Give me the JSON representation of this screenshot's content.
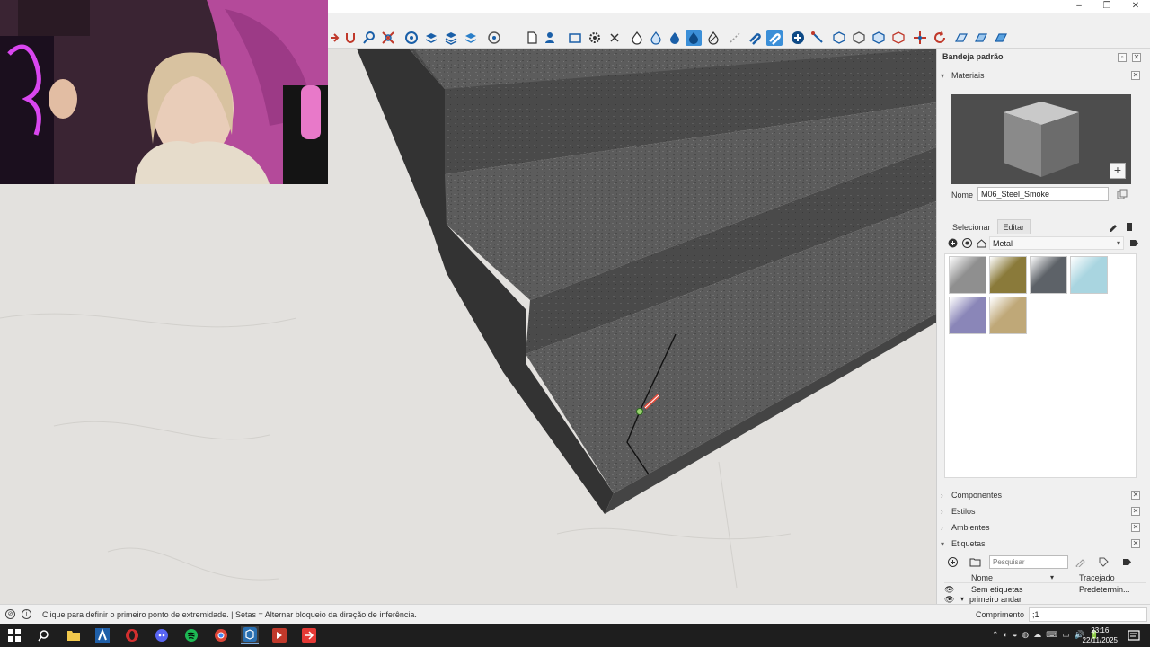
{
  "window": {
    "minimize_label": "–",
    "restore_label": "❐",
    "close_label": "✕"
  },
  "toolbar": {
    "active_tool": "paint-bucket-icon",
    "icons": [
      "scale-icon",
      "rotate-icon",
      "zoom-icon",
      "zoom-extents-icon",
      "section-icon",
      "layers-icon",
      "layers2-icon",
      "styles-icon",
      "page-icon",
      "person-icon",
      "rectangle-icon",
      "settings-icon",
      "close-icon",
      "drop1-icon",
      "drop2-icon",
      "drop3-icon",
      "paint-bucket-icon",
      "eraser-icon",
      "grid-icon",
      "magnet-icon",
      "magnet2-icon",
      "add-icon",
      "wand-icon",
      "solid1-icon",
      "solid2-icon",
      "solid3-icon",
      "solid4-icon",
      "move-icon",
      "rotate2-icon",
      "grid1-icon",
      "grid2-icon",
      "grid3-icon"
    ]
  },
  "tray": {
    "title": "Bandeja padrão",
    "materials_title": "Materiais",
    "name_label": "Nome",
    "name_value": "M06_Steel_Smoke",
    "tab_select": "Selecionar",
    "tab_edit": "Editar",
    "library_value": "Metal",
    "swatch_colors": [
      "#8f8f8f",
      "#8a7a3a",
      "#5d6268",
      "#a9d5e0",
      "#8a86b8",
      "#bfa878"
    ],
    "sections": {
      "components": "Componentes",
      "styles": "Estilos",
      "environments": "Ambientes",
      "tags": "Etiquetas"
    },
    "tags": {
      "search_placeholder": "Pesquisar",
      "col_name": "Nome",
      "col_dash": "Tracejado",
      "rows": [
        {
          "name": "Sem etiquetas",
          "dash": "Predetermin..."
        },
        {
          "name": "primeiro andar",
          "dash": ""
        }
      ]
    }
  },
  "status": {
    "message": "Clique para definir o primeiro ponto de extremidade. | Setas = Alternar bloqueio da direção de inferência.",
    "measure_label": "Comprimento",
    "measure_value": ";1"
  },
  "taskbar": {
    "time": "23:16",
    "date": "22/11/2025"
  },
  "colors": {
    "accent": "#3b8fd8",
    "floor": "#e3e1de",
    "stone_dark": "#3b3b3b",
    "stone_face": "#5a5a5a"
  }
}
